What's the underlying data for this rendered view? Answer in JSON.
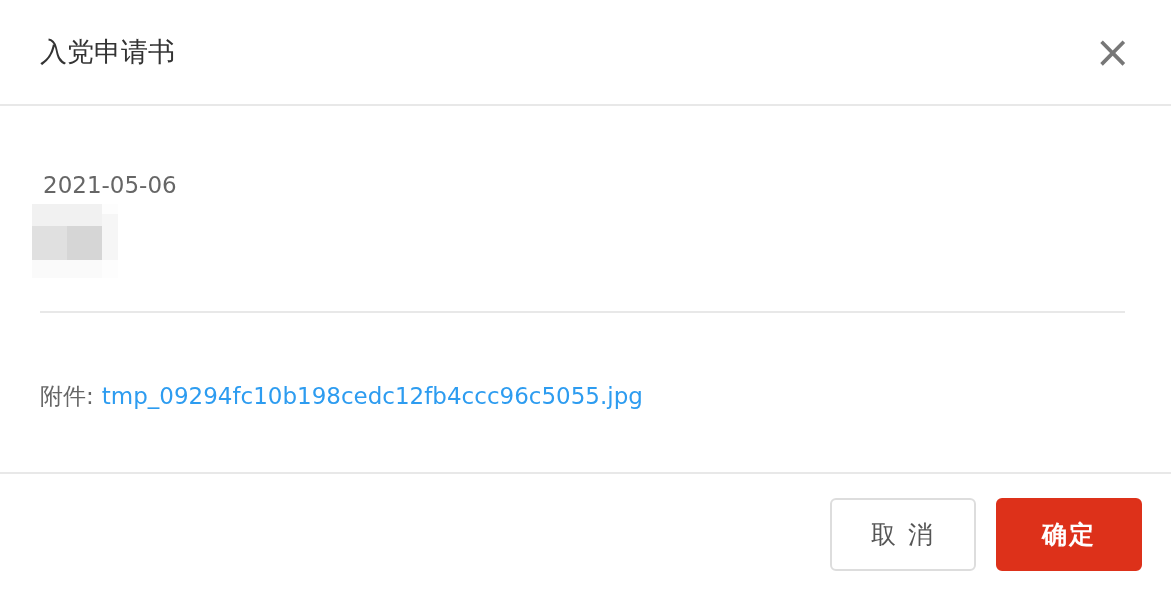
{
  "dialog": {
    "title": "入党申请书",
    "close": "×"
  },
  "content": {
    "date": "2021-05-06",
    "attachment": {
      "label": "附件:",
      "file": "tmp_09294fc10b198cedc12fb4ccc96c5055.jpg"
    }
  },
  "buttons": [
    {
      "label": "取 消",
      "kind": "secondary"
    },
    {
      "label": "确定",
      "kind": "primary"
    }
  ]
}
